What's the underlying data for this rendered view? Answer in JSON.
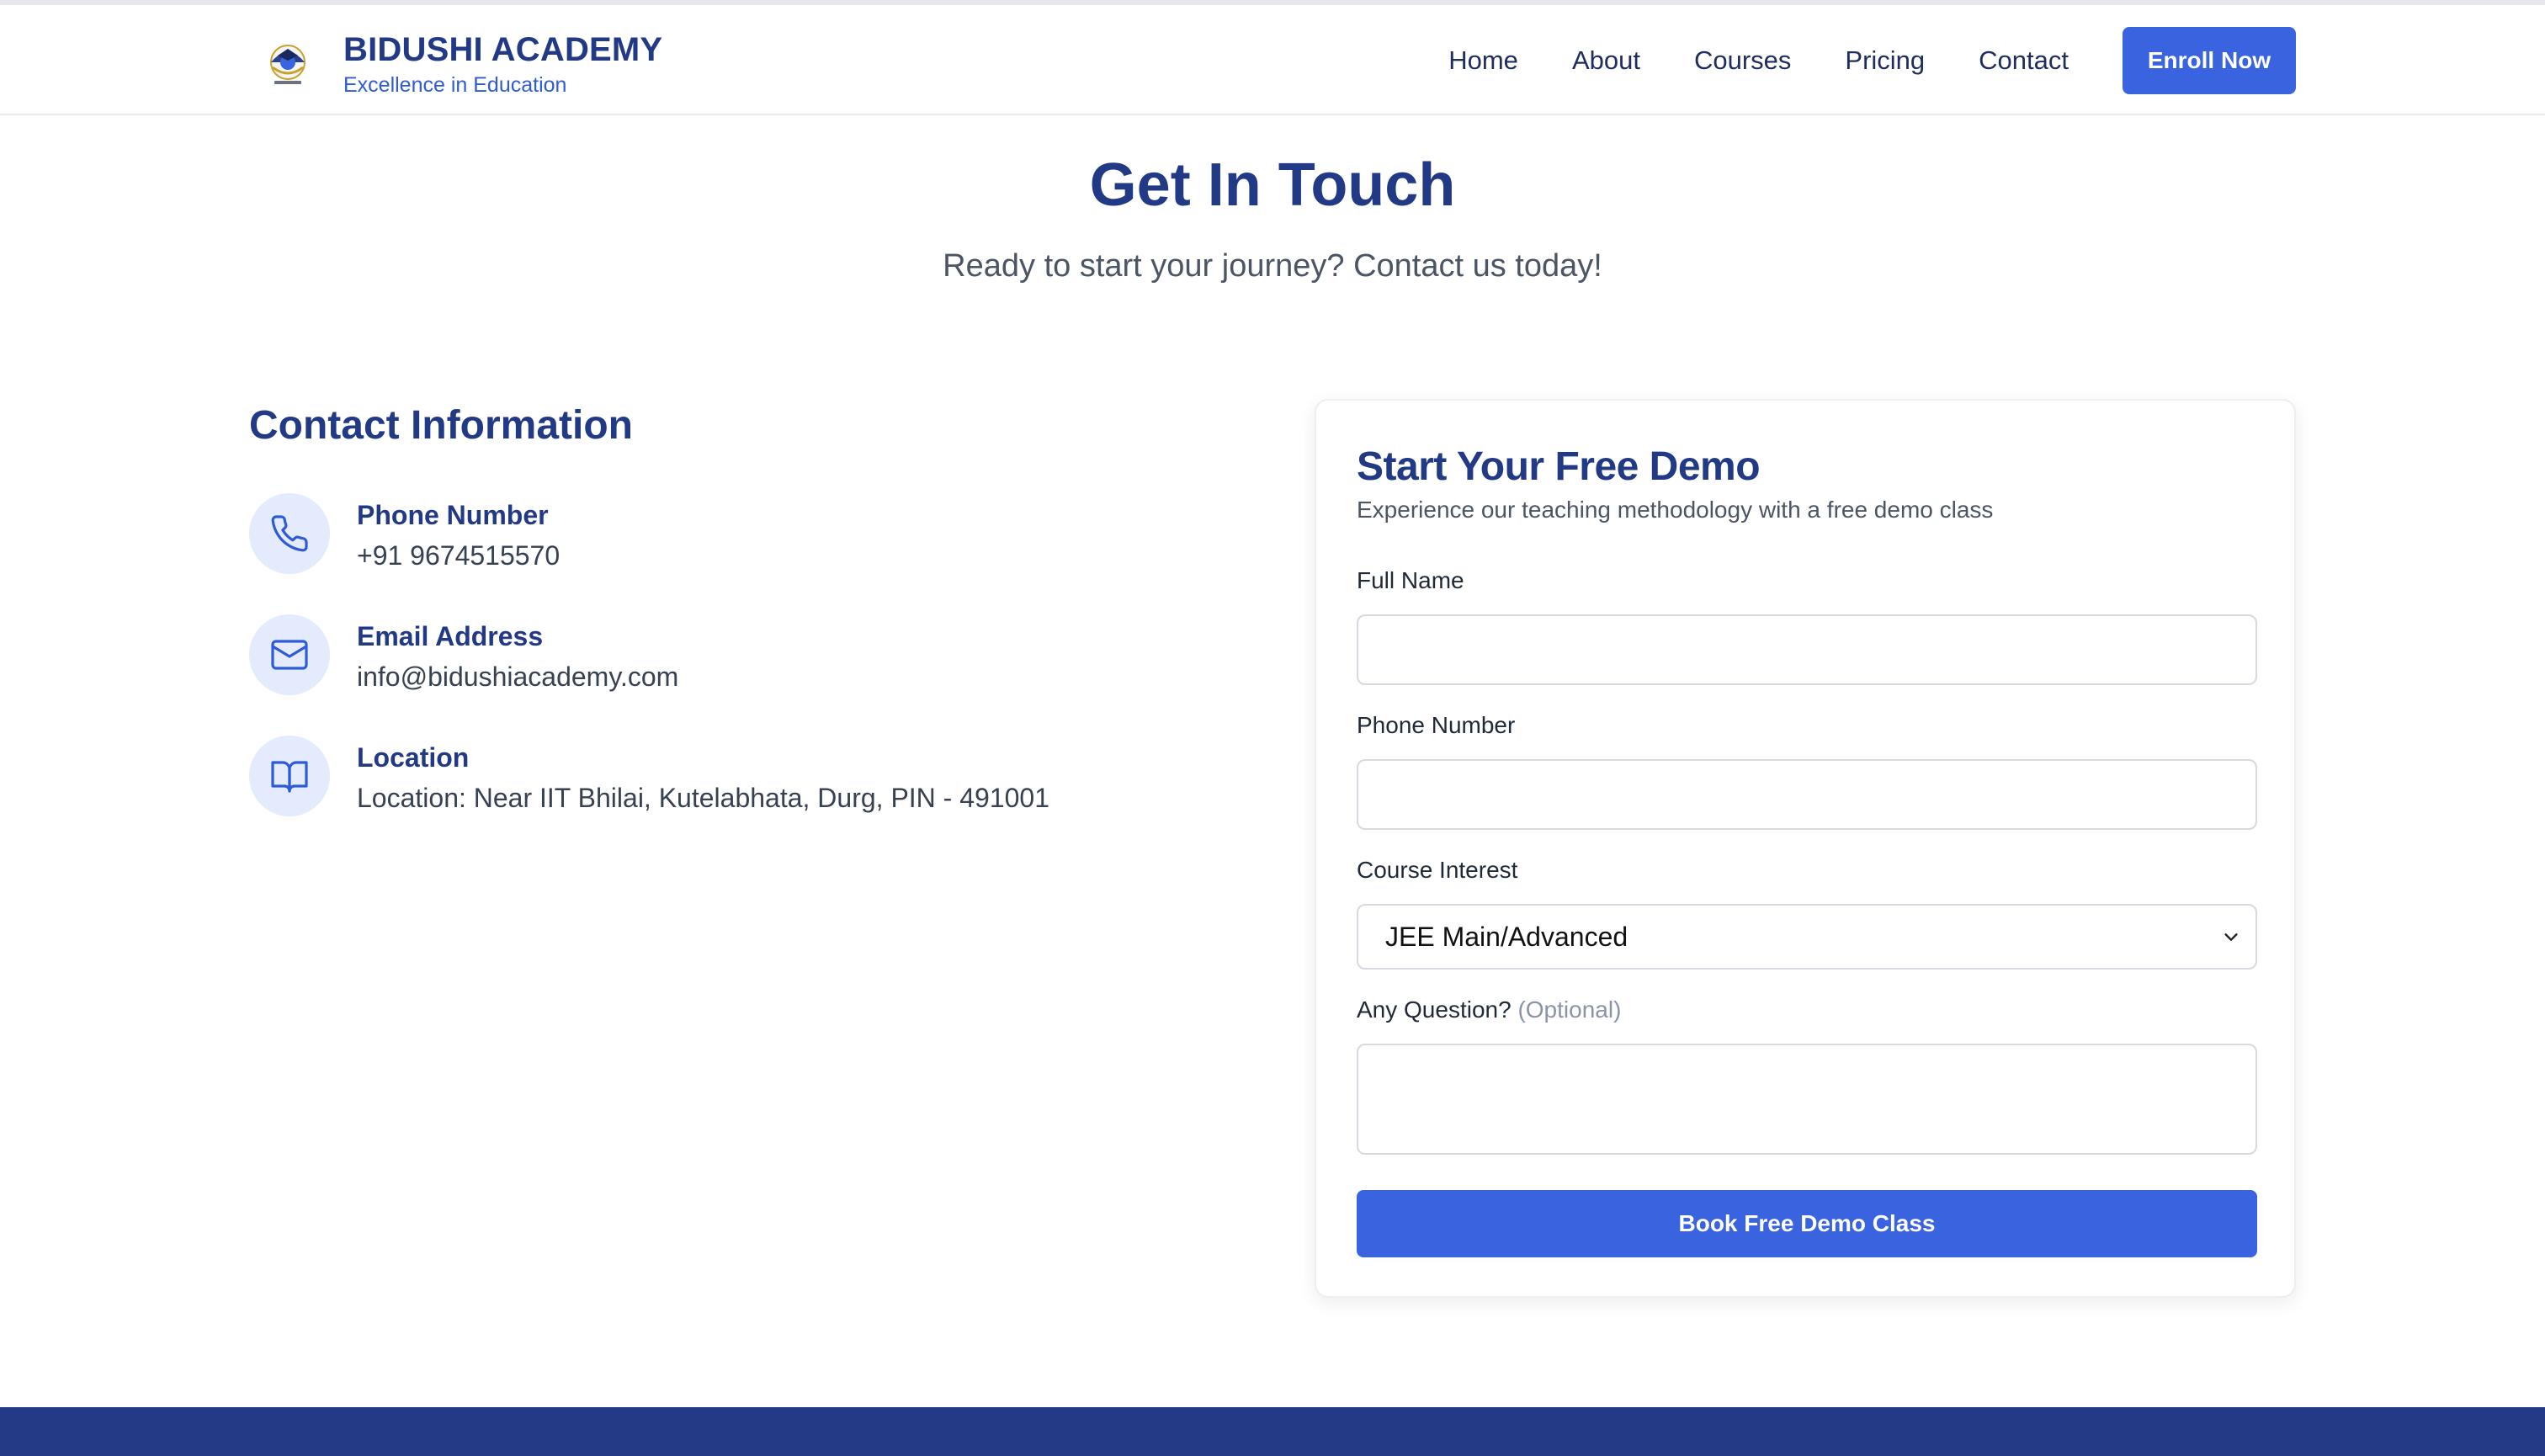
{
  "header": {
    "brand_name": "BIDUSHI ACADEMY",
    "brand_tagline": "Excellence in Education",
    "nav": [
      {
        "label": "Home"
      },
      {
        "label": "About"
      },
      {
        "label": "Courses"
      },
      {
        "label": "Pricing"
      },
      {
        "label": "Contact"
      }
    ],
    "cta_label": "Enroll Now"
  },
  "hero": {
    "title": "Get In Touch",
    "subtitle": "Ready to start your journey? Contact us today!"
  },
  "contact_info": {
    "title": "Contact Information",
    "items": [
      {
        "icon": "phone-icon",
        "label": "Phone Number",
        "value": "+91 9674515570"
      },
      {
        "icon": "mail-icon",
        "label": "Email Address",
        "value": "info@bidushiacademy.com"
      },
      {
        "icon": "book-icon",
        "label": "Location",
        "value": "Location: Near IIT Bhilai, Kutelabhata, Durg, PIN - 491001"
      }
    ]
  },
  "demo_form": {
    "title": "Start Your Free Demo",
    "subtitle": "Experience our teaching methodology with a free demo class",
    "full_name": {
      "label": "Full Name",
      "value": "",
      "placeholder": ""
    },
    "phone": {
      "label": "Phone Number",
      "value": "",
      "placeholder": ""
    },
    "course": {
      "label": "Course Interest",
      "selected": "JEE Main/Advanced"
    },
    "question": {
      "label": "Any Question?",
      "optional_note": "(Optional)",
      "value": "",
      "placeholder": ""
    },
    "submit_label": "Book Free Demo Class"
  },
  "colors": {
    "brand_navy": "#223a86",
    "accent_blue": "#3a63e0",
    "icon_bg": "#e3ebfc",
    "footer": "#243a86"
  }
}
